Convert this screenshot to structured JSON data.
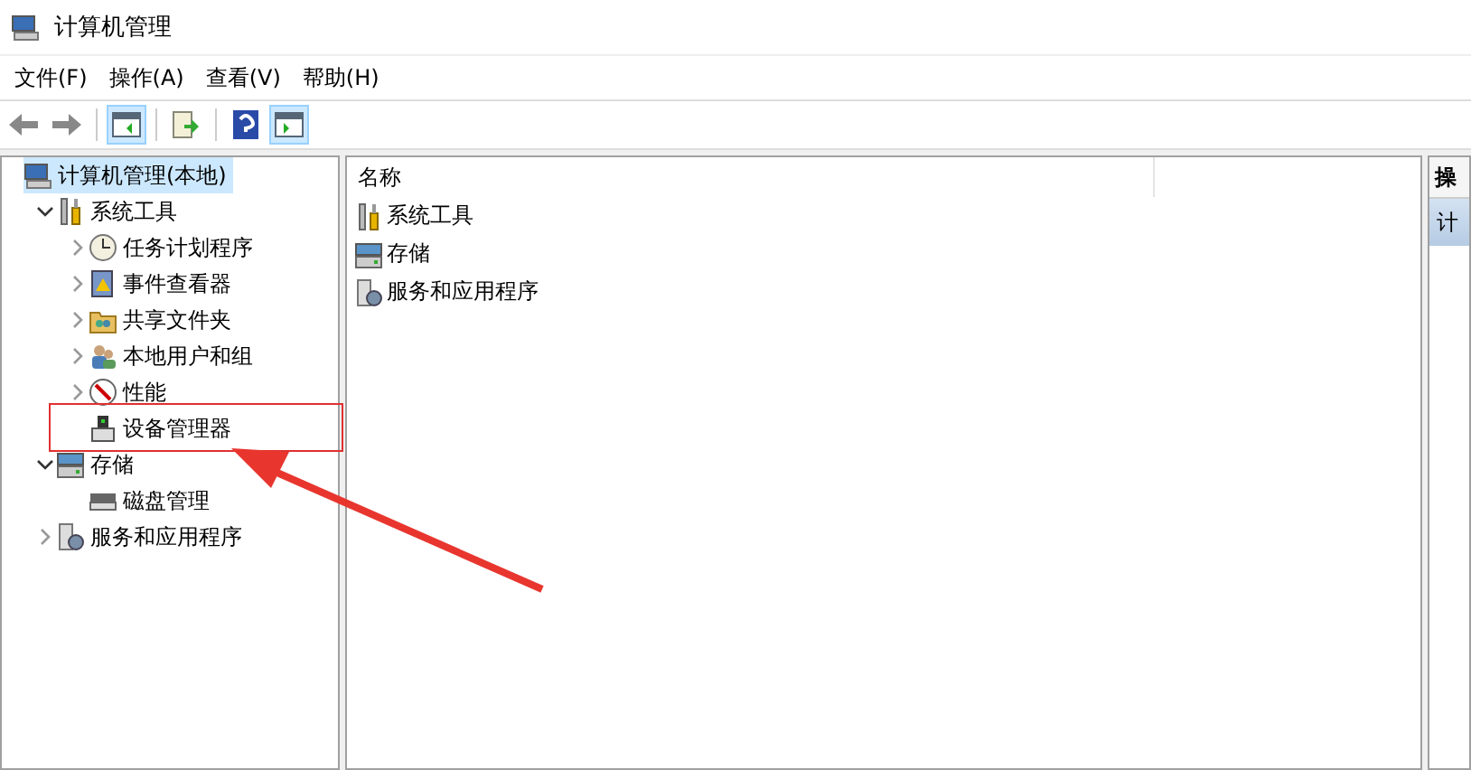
{
  "window": {
    "title": "计算机管理"
  },
  "menu": [
    "文件(F)",
    "操作(A)",
    "查看(V)",
    "帮助(H)"
  ],
  "toolbar": [
    {
      "kind": "back",
      "pressed": false
    },
    {
      "kind": "forward",
      "pressed": false
    },
    {
      "kind": "tree",
      "pressed": true
    },
    {
      "kind": "export",
      "pressed": false
    },
    {
      "kind": "help",
      "pressed": false
    },
    {
      "kind": "actions",
      "pressed": true
    }
  ],
  "tree": [
    {
      "label": "计算机管理(本地)",
      "kind": "computer",
      "selected": true,
      "children": [
        {
          "label": "系统工具",
          "kind": "tools",
          "selected": false,
          "expanded": true,
          "children": [
            {
              "label": "任务计划程序",
              "kind": "clock",
              "selected": false,
              "expanded": false
            },
            {
              "label": "事件查看器",
              "kind": "log",
              "selected": false,
              "expanded": false
            },
            {
              "label": "共享文件夹",
              "kind": "share",
              "selected": false,
              "expanded": false
            },
            {
              "label": "本地用户和组",
              "kind": "users",
              "selected": false,
              "expanded": false
            },
            {
              "label": "性能",
              "kind": "perf",
              "selected": false,
              "expanded": false
            },
            {
              "label": "设备管理器",
              "kind": "device",
              "selected": false
            }
          ]
        },
        {
          "label": "存储",
          "kind": "storage",
          "selected": false,
          "expanded": true,
          "children": [
            {
              "label": "磁盘管理",
              "kind": "disk",
              "selected": false
            }
          ]
        },
        {
          "label": "服务和应用程序",
          "kind": "services",
          "selected": false,
          "expanded": false
        }
      ]
    }
  ],
  "list": {
    "column": "名称",
    "items": [
      {
        "label": "系统工具",
        "kind": "tools"
      },
      {
        "label": "存储",
        "kind": "storage"
      },
      {
        "label": "服务和应用程序",
        "kind": "services"
      }
    ]
  },
  "actions": {
    "header": "操",
    "item": "计"
  }
}
